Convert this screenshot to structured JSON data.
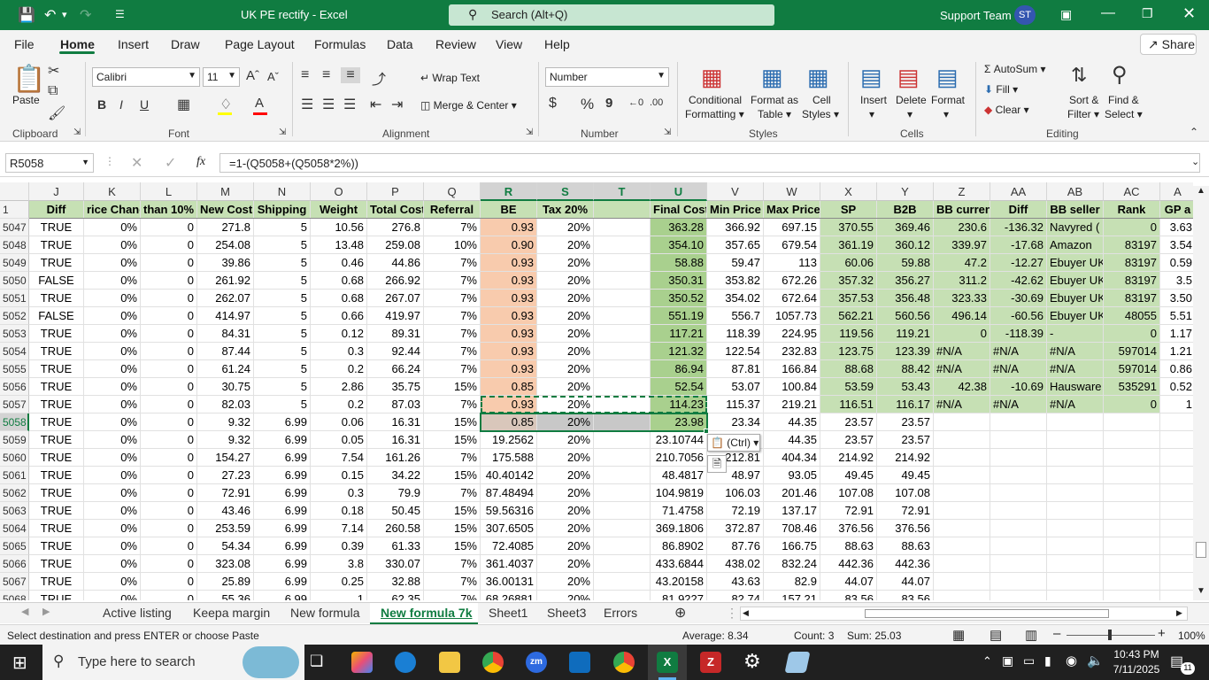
{
  "title": {
    "doc": "UK PE rectify  -  Excel",
    "search": "Search (Alt+Q)",
    "user": "Support Team",
    "initials": "ST"
  },
  "menu": [
    "File",
    "Home",
    "Insert",
    "Draw",
    "Page Layout",
    "Formulas",
    "Data",
    "Review",
    "View",
    "Help"
  ],
  "share": "Share",
  "ribbon": {
    "paste": "Paste",
    "font_name": "Calibri",
    "font_size": "11",
    "wrap_text": "Wrap Text",
    "merge_center": "Merge & Center",
    "number_format": "Number",
    "cond_fmt_1": "Conditional",
    "cond_fmt_2": "Formatting",
    "format_table_1": "Format as",
    "format_table_2": "Table",
    "cell_styles_1": "Cell",
    "cell_styles_2": "Styles",
    "insert": "Insert",
    "delete": "Delete",
    "format": "Format",
    "autosum": "AutoSum",
    "fill": "Fill",
    "clear": "Clear",
    "sort_1": "Sort &",
    "sort_2": "Filter",
    "find_1": "Find &",
    "find_2": "Select",
    "groups": [
      "Clipboard",
      "Font",
      "Alignment",
      "Number",
      "Styles",
      "Cells",
      "Editing"
    ]
  },
  "formula_bar": {
    "name_box": "R5058",
    "fx": "fx",
    "formula": "=1-(Q5058+(Q5058*2%))"
  },
  "grid": {
    "columns": [
      "J",
      "K",
      "L",
      "M",
      "N",
      "O",
      "P",
      "Q",
      "R",
      "S",
      "T",
      "U",
      "V",
      "W",
      "X",
      "Y",
      "Z",
      "AA",
      "AB",
      "AC",
      "A"
    ],
    "header_row_num": "1",
    "headers": [
      "Diff",
      "rice Chang",
      "than 10%",
      "New Cost",
      "Shipping",
      "Weight",
      "Total Cost",
      "Referral",
      "BE",
      "Tax 20%",
      "",
      "Final Cost",
      "Min Price",
      "Max Price",
      "SP",
      "B2B",
      "BB current",
      "Diff",
      "BB seller",
      "Rank",
      "GP a"
    ],
    "rows": [
      {
        "n": "5047",
        "v": [
          "TRUE",
          "0%",
          "0",
          "271.8",
          "5",
          "10.56",
          "276.8",
          "7%",
          "0.93",
          "20%",
          "",
          "363.28",
          "366.92",
          "697.15",
          "370.55",
          "369.46",
          "230.6",
          "-136.32",
          "Navyred (",
          "0",
          "3.63"
        ]
      },
      {
        "n": "5048",
        "v": [
          "TRUE",
          "0%",
          "0",
          "254.08",
          "5",
          "13.48",
          "259.08",
          "10%",
          "0.90",
          "20%",
          "",
          "354.10",
          "357.65",
          "679.54",
          "361.19",
          "360.12",
          "339.97",
          "-17.68",
          "Amazon",
          "83197",
          "3.54"
        ]
      },
      {
        "n": "5049",
        "v": [
          "TRUE",
          "0%",
          "0",
          "39.86",
          "5",
          "0.46",
          "44.86",
          "7%",
          "0.93",
          "20%",
          "",
          "58.88",
          "59.47",
          "113",
          "60.06",
          "59.88",
          "47.2",
          "-12.27",
          "Ebuyer UK",
          "83197",
          "0.59"
        ]
      },
      {
        "n": "5050",
        "v": [
          "FALSE",
          "0%",
          "0",
          "261.92",
          "5",
          "0.68",
          "266.92",
          "7%",
          "0.93",
          "20%",
          "",
          "350.31",
          "353.82",
          "672.26",
          "357.32",
          "356.27",
          "311.2",
          "-42.62",
          "Ebuyer UK",
          "83197",
          "3.5"
        ]
      },
      {
        "n": "5051",
        "v": [
          "TRUE",
          "0%",
          "0",
          "262.07",
          "5",
          "0.68",
          "267.07",
          "7%",
          "0.93",
          "20%",
          "",
          "350.52",
          "354.02",
          "672.64",
          "357.53",
          "356.48",
          "323.33",
          "-30.69",
          "Ebuyer UK",
          "83197",
          "3.50"
        ]
      },
      {
        "n": "5052",
        "v": [
          "FALSE",
          "0%",
          "0",
          "414.97",
          "5",
          "0.66",
          "419.97",
          "7%",
          "0.93",
          "20%",
          "",
          "551.19",
          "556.7",
          "1057.73",
          "562.21",
          "560.56",
          "496.14",
          "-60.56",
          "Ebuyer UK",
          "48055",
          "5.51"
        ]
      },
      {
        "n": "5053",
        "v": [
          "TRUE",
          "0%",
          "0",
          "84.31",
          "5",
          "0.12",
          "89.31",
          "7%",
          "0.93",
          "20%",
          "",
          "117.21",
          "118.39",
          "224.95",
          "119.56",
          "119.21",
          "0",
          "-118.39",
          "-",
          "0",
          "1.17"
        ]
      },
      {
        "n": "5054",
        "v": [
          "TRUE",
          "0%",
          "0",
          "87.44",
          "5",
          "0.3",
          "92.44",
          "7%",
          "0.93",
          "20%",
          "",
          "121.32",
          "122.54",
          "232.83",
          "123.75",
          "123.39",
          "#N/A",
          "#N/A",
          "#N/A",
          "597014",
          "1.21"
        ]
      },
      {
        "n": "5055",
        "v": [
          "TRUE",
          "0%",
          "0",
          "61.24",
          "5",
          "0.2",
          "66.24",
          "7%",
          "0.93",
          "20%",
          "",
          "86.94",
          "87.81",
          "166.84",
          "88.68",
          "88.42",
          "#N/A",
          "#N/A",
          "#N/A",
          "597014",
          "0.86"
        ]
      },
      {
        "n": "5056",
        "v": [
          "TRUE",
          "0%",
          "0",
          "30.75",
          "5",
          "2.86",
          "35.75",
          "15%",
          "0.85",
          "20%",
          "",
          "52.54",
          "53.07",
          "100.84",
          "53.59",
          "53.43",
          "42.38",
          "-10.69",
          "Hausware",
          "535291",
          "0.52"
        ]
      },
      {
        "n": "5057",
        "v": [
          "TRUE",
          "0%",
          "0",
          "82.03",
          "5",
          "0.2",
          "87.03",
          "7%",
          "0.93",
          "20%",
          "",
          "114.23",
          "115.37",
          "219.21",
          "116.51",
          "116.17",
          "#N/A",
          "#N/A",
          "#N/A",
          "0",
          "1"
        ]
      },
      {
        "n": "5058",
        "v": [
          "TRUE",
          "0%",
          "0",
          "9.32",
          "6.99",
          "0.06",
          "16.31",
          "15%",
          "0.85",
          "20%",
          "",
          "23.98",
          "23.34",
          "44.35",
          "23.57",
          "23.57",
          "",
          "",
          "",
          "",
          ""
        ]
      },
      {
        "n": "5059",
        "v": [
          "TRUE",
          "0%",
          "0",
          "9.32",
          "6.99",
          "0.05",
          "16.31",
          "15%",
          "19.2562",
          "20%",
          "",
          "23.10744",
          "23.34",
          "44.35",
          "23.57",
          "23.57",
          "",
          "",
          "",
          "",
          ""
        ]
      },
      {
        "n": "5060",
        "v": [
          "TRUE",
          "0%",
          "0",
          "154.27",
          "6.99",
          "7.54",
          "161.26",
          "7%",
          "175.588",
          "20%",
          "",
          "210.7056",
          "212.81",
          "404.34",
          "214.92",
          "214.92",
          "",
          "",
          "",
          "",
          ""
        ]
      },
      {
        "n": "5061",
        "v": [
          "TRUE",
          "0%",
          "0",
          "27.23",
          "6.99",
          "0.15",
          "34.22",
          "15%",
          "40.40142",
          "20%",
          "",
          "48.4817",
          "48.97",
          "93.05",
          "49.45",
          "49.45",
          "",
          "",
          "",
          "",
          ""
        ]
      },
      {
        "n": "5062",
        "v": [
          "TRUE",
          "0%",
          "0",
          "72.91",
          "6.99",
          "0.3",
          "79.9",
          "7%",
          "87.48494",
          "20%",
          "",
          "104.9819",
          "106.03",
          "201.46",
          "107.08",
          "107.08",
          "",
          "",
          "",
          "",
          ""
        ]
      },
      {
        "n": "5063",
        "v": [
          "TRUE",
          "0%",
          "0",
          "43.46",
          "6.99",
          "0.18",
          "50.45",
          "15%",
          "59.56316",
          "20%",
          "",
          "71.4758",
          "72.19",
          "137.17",
          "72.91",
          "72.91",
          "",
          "",
          "",
          "",
          ""
        ]
      },
      {
        "n": "5064",
        "v": [
          "TRUE",
          "0%",
          "0",
          "253.59",
          "6.99",
          "7.14",
          "260.58",
          "15%",
          "307.6505",
          "20%",
          "",
          "369.1806",
          "372.87",
          "708.46",
          "376.56",
          "376.56",
          "",
          "",
          "",
          "",
          ""
        ]
      },
      {
        "n": "5065",
        "v": [
          "TRUE",
          "0%",
          "0",
          "54.34",
          "6.99",
          "0.39",
          "61.33",
          "15%",
          "72.4085",
          "20%",
          "",
          "86.8902",
          "87.76",
          "166.75",
          "88.63",
          "88.63",
          "",
          "",
          "",
          "",
          ""
        ]
      },
      {
        "n": "5066",
        "v": [
          "TRUE",
          "0%",
          "0",
          "323.08",
          "6.99",
          "3.8",
          "330.07",
          "7%",
          "361.4037",
          "20%",
          "",
          "433.6844",
          "438.02",
          "832.24",
          "442.36",
          "442.36",
          "",
          "",
          "",
          "",
          ""
        ]
      },
      {
        "n": "5067",
        "v": [
          "TRUE",
          "0%",
          "0",
          "25.89",
          "6.99",
          "0.25",
          "32.88",
          "7%",
          "36.00131",
          "20%",
          "",
          "43.20158",
          "43.63",
          "82.9",
          "44.07",
          "44.07",
          "",
          "",
          "",
          "",
          ""
        ]
      },
      {
        "n": "5068",
        "v": [
          "TRUE",
          "0%",
          "0",
          "55.36",
          "6.99",
          "1",
          "62.35",
          "7%",
          "68.26881",
          "20%",
          "",
          "81.9227",
          "82.74",
          "157.21",
          "83.56",
          "83.56",
          "",
          "",
          "",
          "",
          ""
        ]
      }
    ],
    "paste_options": "(Ctrl)"
  },
  "colors": {
    "be_fill": "#f8cbad",
    "green_fill": "#a9d08e",
    "light_green_fill": "#c6e0b4",
    "header_fill": "#c6e0b4",
    "excel_green": "#107c41"
  },
  "tabs": [
    "Active listing",
    "Keepa margin",
    "New formula",
    "New formula 7k",
    "Sheet1",
    "Sheet3",
    "Errors"
  ],
  "active_tab": "New formula 7k",
  "status": {
    "message": "Select destination and press ENTER or choose Paste",
    "average": "Average: 8.34",
    "count": "Count: 3",
    "sum": "Sum: 25.03",
    "zoom": "100%"
  },
  "taskbar": {
    "search": "Type here to search",
    "time": "10:43 PM",
    "date": "7/11/2025",
    "notifications": "11"
  }
}
